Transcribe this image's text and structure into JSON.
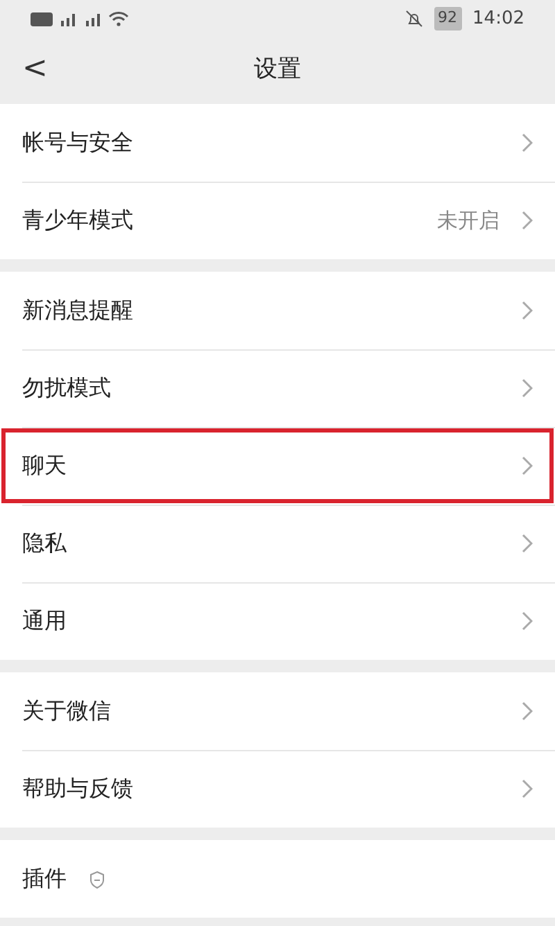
{
  "status_bar": {
    "battery": "92",
    "time": "14:02"
  },
  "header": {
    "back": "<",
    "title": "设置"
  },
  "groups": [
    {
      "items": [
        {
          "label": "帐号与安全",
          "highlighted": false,
          "chevron": true
        },
        {
          "label": "青少年模式",
          "value": "未开启",
          "highlighted": false,
          "chevron": true
        }
      ]
    },
    {
      "items": [
        {
          "label": "新消息提醒",
          "highlighted": false,
          "chevron": true
        },
        {
          "label": "勿扰模式",
          "highlighted": false,
          "chevron": true
        },
        {
          "label": "聊天",
          "highlighted": true,
          "chevron": true
        },
        {
          "label": "隐私",
          "highlighted": false,
          "chevron": true
        },
        {
          "label": "通用",
          "highlighted": false,
          "chevron": true
        }
      ]
    },
    {
      "items": [
        {
          "label": "关于微信",
          "highlighted": false,
          "chevron": true
        },
        {
          "label": "帮助与反馈",
          "highlighted": false,
          "chevron": true
        }
      ]
    },
    {
      "items": [
        {
          "label": "插件",
          "badge_icon": true,
          "highlighted": false,
          "chevron": false
        }
      ]
    }
  ]
}
